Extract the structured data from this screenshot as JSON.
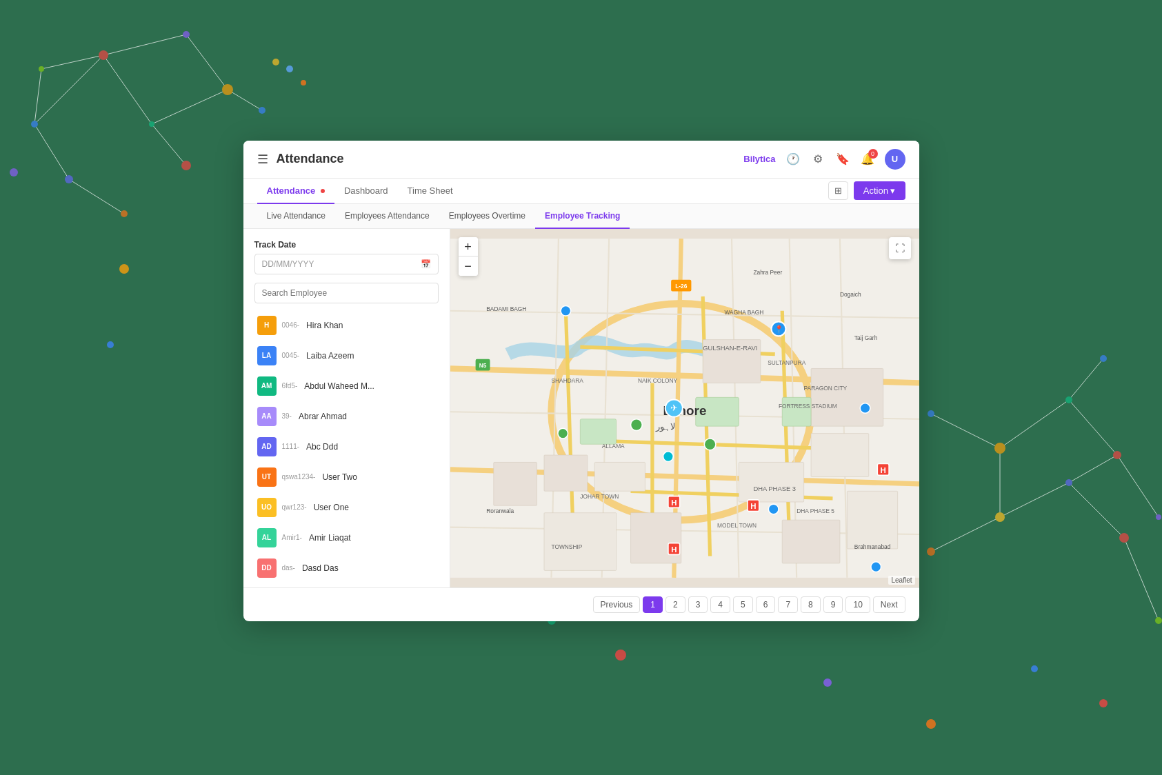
{
  "header": {
    "menu_label": "☰",
    "title": "Attendance",
    "brand": "Bilytica",
    "icons": {
      "clock": "🕐",
      "gear": "⚙",
      "bookmark": "🔖",
      "bell": "🔔"
    },
    "notification_count": "0",
    "avatar_initials": "U"
  },
  "nav": {
    "tabs": [
      {
        "label": "Attendance",
        "active": true,
        "has_dot": true
      },
      {
        "label": "Dashboard",
        "active": false
      },
      {
        "label": "Time Sheet",
        "active": false
      }
    ],
    "filter_label": "⊞",
    "action_label": "Action ▾"
  },
  "sub_tabs": [
    {
      "label": "Live Attendance",
      "active": false
    },
    {
      "label": "Employees Attendance",
      "active": false
    },
    {
      "label": "Employees Overtime",
      "active": false
    },
    {
      "label": "Employee Tracking",
      "active": true
    }
  ],
  "left_panel": {
    "track_date_label": "Track Date",
    "date_placeholder": "DD/MM/YYYY",
    "search_placeholder": "Search Employee",
    "employees": [
      {
        "initials": "H",
        "color": "#f59e0b",
        "code": "0046-",
        "name": "Hira Khan"
      },
      {
        "initials": "LA",
        "color": "#3b82f6",
        "code": "0045-",
        "name": "Laiba Azeem"
      },
      {
        "initials": "AM",
        "color": "#10b981",
        "code": "6fd5-",
        "name": "Abdul Waheed M..."
      },
      {
        "initials": "AA",
        "color": "#a78bfa",
        "code": "39-",
        "name": "Abrar Ahmad"
      },
      {
        "initials": "AD",
        "color": "#6366f1",
        "code": "1111-",
        "name": "Abc Ddd"
      },
      {
        "initials": "UT",
        "color": "#f97316",
        "code": "qswa1234-",
        "name": "User Two"
      },
      {
        "initials": "UO",
        "color": "#fbbf24",
        "code": "qwr123-",
        "name": "User One"
      },
      {
        "initials": "AL",
        "color": "#34d399",
        "code": "Amir1-",
        "name": "Amir Liaqat"
      },
      {
        "initials": "DD",
        "color": "#f87171",
        "code": "das-",
        "name": "Dasd Das"
      }
    ]
  },
  "map": {
    "zoom_in": "+",
    "zoom_out": "−",
    "leaflet_credit": "Leaflet"
  },
  "pagination": {
    "previous_label": "Previous",
    "next_label": "Next",
    "pages": [
      "1",
      "2",
      "3",
      "4",
      "5",
      "6",
      "7",
      "8",
      "9",
      "10"
    ],
    "active_page": "1"
  }
}
